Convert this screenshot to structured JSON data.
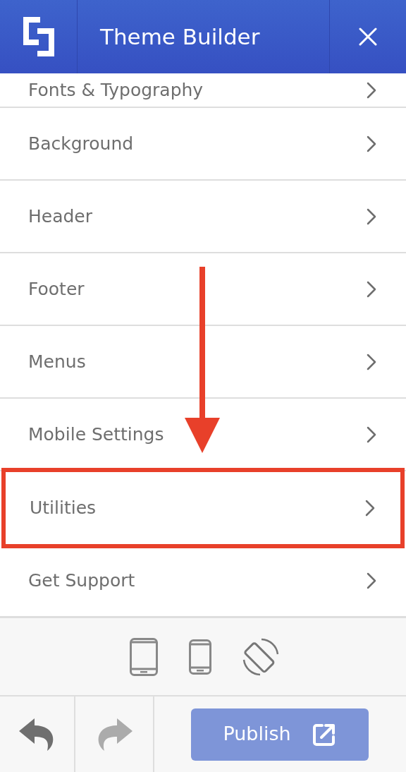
{
  "header": {
    "title": "Theme Builder"
  },
  "menu_items": [
    {
      "label": "Fonts & Typography",
      "highlighted": false
    },
    {
      "label": "Background",
      "highlighted": false
    },
    {
      "label": "Header",
      "highlighted": false
    },
    {
      "label": "Footer",
      "highlighted": false
    },
    {
      "label": "Menus",
      "highlighted": false
    },
    {
      "label": "Mobile Settings",
      "highlighted": false
    },
    {
      "label": "Utilities",
      "highlighted": true
    },
    {
      "label": "Get Support",
      "highlighted": false
    }
  ],
  "toolbar": {
    "undo": {
      "disabled": false
    },
    "redo": {
      "disabled": true
    },
    "publish": {
      "label": "Publish"
    }
  }
}
